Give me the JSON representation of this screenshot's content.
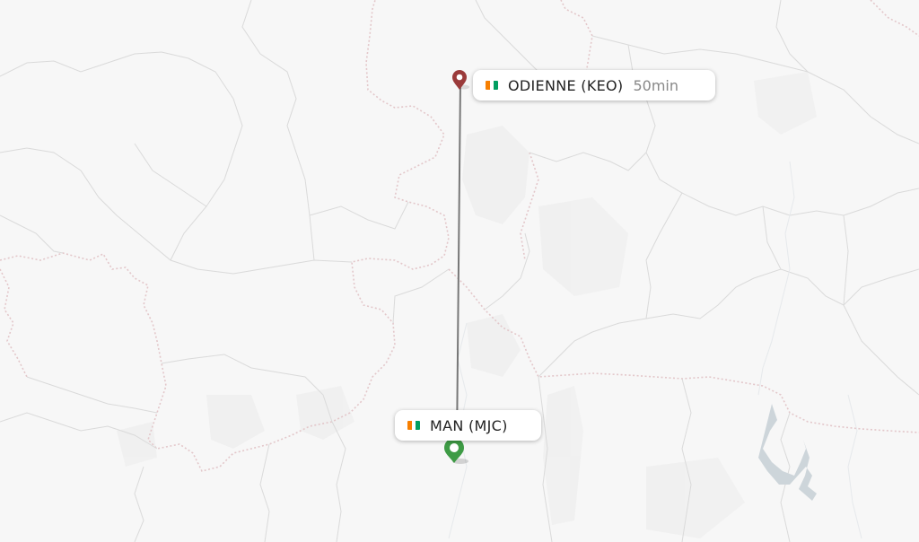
{
  "route": {
    "origin": {
      "label": "MAN (MJC)",
      "flag_colors": [
        "#f77f00",
        "#ffffff",
        "#009e60"
      ],
      "marker_color": "#3e9b45",
      "marker_icon": "map-pin-icon"
    },
    "destination": {
      "label": "ODIENNE (KEO)",
      "duration": "50min",
      "flag_colors": [
        "#f77f00",
        "#ffffff",
        "#009e60"
      ],
      "marker_color": "#9b3b3b",
      "marker_icon": "map-pin-icon"
    },
    "line_color": "#777777"
  },
  "map": {
    "background_color": "#f7f7f7",
    "border_color": "#e3c7ca",
    "admin_border_color": "#d6d6d6",
    "water_color": "#cdd5da"
  }
}
